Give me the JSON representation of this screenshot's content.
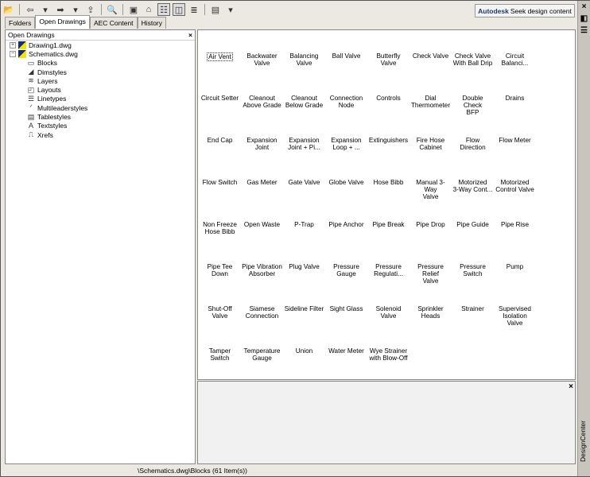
{
  "toolbar": {
    "buttons": [
      "open-icon",
      "back-icon",
      "forward-icon",
      "up-icon",
      "search-icon",
      "favorites-icon",
      "home-icon",
      "tree-toggle-icon",
      "preview-icon",
      "description-icon",
      "views-icon"
    ]
  },
  "seek": {
    "brand": "Autodesk",
    "text": "Seek design content"
  },
  "tabs": [
    "Folders",
    "Open Drawings",
    "AEC Content",
    "History"
  ],
  "left": {
    "title": "Open Drawings",
    "close": "×",
    "drawings": [
      "Drawing1.dwg",
      "Schematics.dwg"
    ],
    "children": [
      "Blocks",
      "Dimstyles",
      "Layers",
      "Layouts",
      "Linetypes",
      "Multileaderstyles",
      "Tablestyles",
      "Textstyles",
      "Xrefs"
    ]
  },
  "items": [
    "Air Vent",
    "Backwater\nValve",
    "Balancing\nValve",
    "Ball Valve",
    "Butterfly Valve",
    "Check Valve",
    "Check Valve\nWith Ball Drip",
    "Circuit\nBalanci...",
    "Circuit Setter",
    "Cleanout\nAbove Grade",
    "Cleanout\nBelow Grade",
    "Connection\nNode",
    "Controls",
    "Dial\nThermometer",
    "Double Check\nBFP",
    "Drains",
    "End Cap",
    "Expansion\nJoint",
    "Expansion\nJoint + Pi...",
    "Expansion\nLoop + ...",
    "Extinguishers",
    "Fire Hose\nCabinet",
    "Flow Direction",
    "Flow Meter",
    "Flow Switch",
    "Gas Meter",
    "Gate Valve",
    "Globe Valve",
    "Hose Bibb",
    "Manual 3-Way\nValve",
    "Motorized\n3-Way Cont...",
    "Motorized\nControl Valve",
    "Non Freeze\nHose Bibb",
    "Open Waste",
    "P-Trap",
    "Pipe Anchor",
    "Pipe Break",
    "Pipe Drop",
    "Pipe Guide",
    "Pipe Rise",
    "Pipe Tee\nDown",
    "Pipe Vibration\nAbsorber",
    "Plug Valve",
    "Pressure\nGauge",
    "Pressure\nRegulati...",
    "Pressure Relief\nValve",
    "Pressure\nSwitch",
    "Pump",
    "Shut-Off Valve",
    "Siamese\nConnection",
    "Sideline Filter",
    "Sight Glass",
    "Solenoid Valve",
    "Sprinkler\nHeads",
    "Strainer",
    "Supervised\nIsolation Valve",
    "Tamper Switch",
    "Temperature\nGauge",
    "Union",
    "Water Meter",
    "Wye Strainer\nwith Blow-Off"
  ],
  "preview": {
    "close": "×"
  },
  "status": "\\Schematics.dwg\\Blocks (61 Item(s))",
  "side": {
    "close": "×",
    "label": "DesignCenter"
  }
}
